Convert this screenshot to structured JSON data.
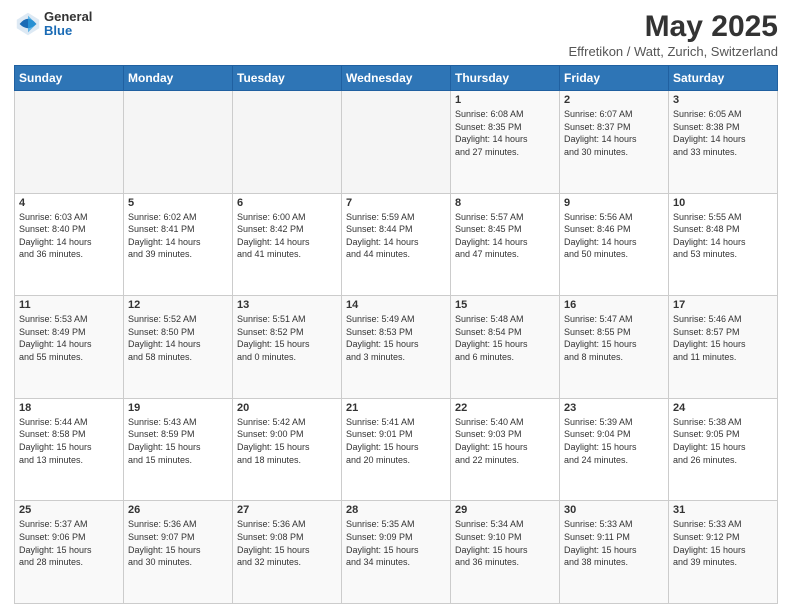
{
  "header": {
    "logo_general": "General",
    "logo_blue": "Blue",
    "main_title": "May 2025",
    "subtitle": "Effretikon / Watt, Zurich, Switzerland"
  },
  "days_of_week": [
    "Sunday",
    "Monday",
    "Tuesday",
    "Wednesday",
    "Thursday",
    "Friday",
    "Saturday"
  ],
  "weeks": [
    [
      {
        "day": "",
        "info": ""
      },
      {
        "day": "",
        "info": ""
      },
      {
        "day": "",
        "info": ""
      },
      {
        "day": "",
        "info": ""
      },
      {
        "day": "1",
        "info": "Sunrise: 6:08 AM\nSunset: 8:35 PM\nDaylight: 14 hours\nand 27 minutes."
      },
      {
        "day": "2",
        "info": "Sunrise: 6:07 AM\nSunset: 8:37 PM\nDaylight: 14 hours\nand 30 minutes."
      },
      {
        "day": "3",
        "info": "Sunrise: 6:05 AM\nSunset: 8:38 PM\nDaylight: 14 hours\nand 33 minutes."
      }
    ],
    [
      {
        "day": "4",
        "info": "Sunrise: 6:03 AM\nSunset: 8:40 PM\nDaylight: 14 hours\nand 36 minutes."
      },
      {
        "day": "5",
        "info": "Sunrise: 6:02 AM\nSunset: 8:41 PM\nDaylight: 14 hours\nand 39 minutes."
      },
      {
        "day": "6",
        "info": "Sunrise: 6:00 AM\nSunset: 8:42 PM\nDaylight: 14 hours\nand 41 minutes."
      },
      {
        "day": "7",
        "info": "Sunrise: 5:59 AM\nSunset: 8:44 PM\nDaylight: 14 hours\nand 44 minutes."
      },
      {
        "day": "8",
        "info": "Sunrise: 5:57 AM\nSunset: 8:45 PM\nDaylight: 14 hours\nand 47 minutes."
      },
      {
        "day": "9",
        "info": "Sunrise: 5:56 AM\nSunset: 8:46 PM\nDaylight: 14 hours\nand 50 minutes."
      },
      {
        "day": "10",
        "info": "Sunrise: 5:55 AM\nSunset: 8:48 PM\nDaylight: 14 hours\nand 53 minutes."
      }
    ],
    [
      {
        "day": "11",
        "info": "Sunrise: 5:53 AM\nSunset: 8:49 PM\nDaylight: 14 hours\nand 55 minutes."
      },
      {
        "day": "12",
        "info": "Sunrise: 5:52 AM\nSunset: 8:50 PM\nDaylight: 14 hours\nand 58 minutes."
      },
      {
        "day": "13",
        "info": "Sunrise: 5:51 AM\nSunset: 8:52 PM\nDaylight: 15 hours\nand 0 minutes."
      },
      {
        "day": "14",
        "info": "Sunrise: 5:49 AM\nSunset: 8:53 PM\nDaylight: 15 hours\nand 3 minutes."
      },
      {
        "day": "15",
        "info": "Sunrise: 5:48 AM\nSunset: 8:54 PM\nDaylight: 15 hours\nand 6 minutes."
      },
      {
        "day": "16",
        "info": "Sunrise: 5:47 AM\nSunset: 8:55 PM\nDaylight: 15 hours\nand 8 minutes."
      },
      {
        "day": "17",
        "info": "Sunrise: 5:46 AM\nSunset: 8:57 PM\nDaylight: 15 hours\nand 11 minutes."
      }
    ],
    [
      {
        "day": "18",
        "info": "Sunrise: 5:44 AM\nSunset: 8:58 PM\nDaylight: 15 hours\nand 13 minutes."
      },
      {
        "day": "19",
        "info": "Sunrise: 5:43 AM\nSunset: 8:59 PM\nDaylight: 15 hours\nand 15 minutes."
      },
      {
        "day": "20",
        "info": "Sunrise: 5:42 AM\nSunset: 9:00 PM\nDaylight: 15 hours\nand 18 minutes."
      },
      {
        "day": "21",
        "info": "Sunrise: 5:41 AM\nSunset: 9:01 PM\nDaylight: 15 hours\nand 20 minutes."
      },
      {
        "day": "22",
        "info": "Sunrise: 5:40 AM\nSunset: 9:03 PM\nDaylight: 15 hours\nand 22 minutes."
      },
      {
        "day": "23",
        "info": "Sunrise: 5:39 AM\nSunset: 9:04 PM\nDaylight: 15 hours\nand 24 minutes."
      },
      {
        "day": "24",
        "info": "Sunrise: 5:38 AM\nSunset: 9:05 PM\nDaylight: 15 hours\nand 26 minutes."
      }
    ],
    [
      {
        "day": "25",
        "info": "Sunrise: 5:37 AM\nSunset: 9:06 PM\nDaylight: 15 hours\nand 28 minutes."
      },
      {
        "day": "26",
        "info": "Sunrise: 5:36 AM\nSunset: 9:07 PM\nDaylight: 15 hours\nand 30 minutes."
      },
      {
        "day": "27",
        "info": "Sunrise: 5:36 AM\nSunset: 9:08 PM\nDaylight: 15 hours\nand 32 minutes."
      },
      {
        "day": "28",
        "info": "Sunrise: 5:35 AM\nSunset: 9:09 PM\nDaylight: 15 hours\nand 34 minutes."
      },
      {
        "day": "29",
        "info": "Sunrise: 5:34 AM\nSunset: 9:10 PM\nDaylight: 15 hours\nand 36 minutes."
      },
      {
        "day": "30",
        "info": "Sunrise: 5:33 AM\nSunset: 9:11 PM\nDaylight: 15 hours\nand 38 minutes."
      },
      {
        "day": "31",
        "info": "Sunrise: 5:33 AM\nSunset: 9:12 PM\nDaylight: 15 hours\nand 39 minutes."
      }
    ]
  ]
}
